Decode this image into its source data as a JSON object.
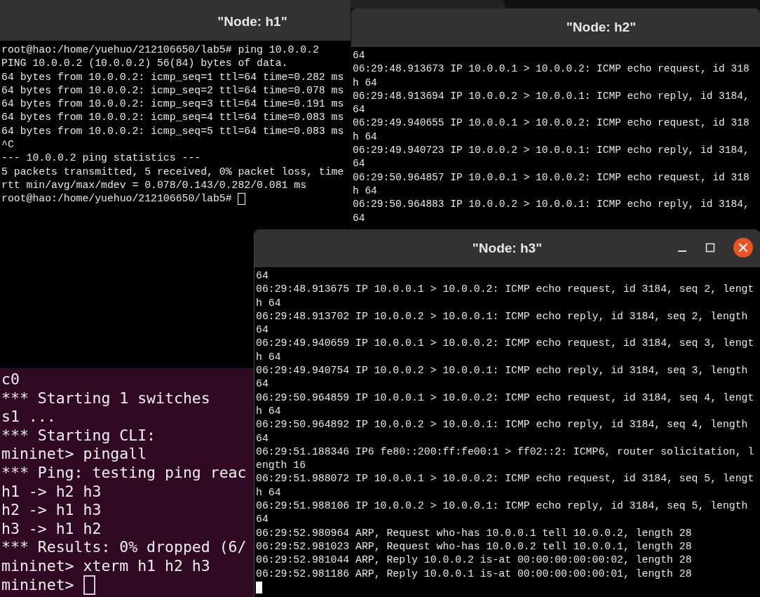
{
  "windows": [
    {
      "title": "\"Node: h1\"",
      "focused": false,
      "cursor": true,
      "lines": [
        "root@hao:/home/yuehuo/212106650/lab5# ping 10.0.0.2",
        "PING 10.0.0.2 (10.0.0.2) 56(84) bytes of data.",
        "64 bytes from 10.0.0.2: icmp_seq=1 ttl=64 time=0.282 ms",
        "64 bytes from 10.0.0.2: icmp_seq=2 ttl=64 time=0.078 ms",
        "64 bytes from 10.0.0.2: icmp_seq=3 ttl=64 time=0.191 ms",
        "64 bytes from 10.0.0.2: icmp_seq=4 ttl=64 time=0.083 ms",
        "64 bytes from 10.0.0.2: icmp_seq=5 ttl=64 time=0.083 ms",
        "^C",
        "--- 10.0.0.2 ping statistics ---",
        "5 packets transmitted, 5 received, 0% packet loss, time",
        "rtt min/avg/max/mdev = 0.078/0.143/0.282/0.081 ms",
        "root@hao:/home/yuehuo/212106650/lab5# "
      ]
    },
    {
      "title": "\"Node: h2\"",
      "focused": false,
      "lines": [
        "64",
        "06:29:48.913673 IP 10.0.0.1 > 10.0.0.2: ICMP echo request, id 318",
        "h 64",
        "06:29:48.913694 IP 10.0.0.2 > 10.0.0.1: ICMP echo reply, id 3184,",
        "64",
        "06:29:49.940655 IP 10.0.0.1 > 10.0.0.2: ICMP echo request, id 318",
        "h 64",
        "06:29:49.940723 IP 10.0.0.2 > 10.0.0.1: ICMP echo reply, id 3184,",
        "64",
        "06:29:50.964857 IP 10.0.0.1 > 10.0.0.2: ICMP echo request, id 318",
        "h 64",
        "06:29:50.964883 IP 10.0.0.2 > 10.0.0.1: ICMP echo reply, id 3184,",
        "64"
      ]
    },
    {
      "title": "\"Node: h3\"",
      "focused": true,
      "cursor": true,
      "lines": [
        "64",
        "06:29:48.913675 IP 10.0.0.1 > 10.0.0.2: ICMP echo request, id 3184, seq 2, lengt",
        "h 64",
        "06:29:48.913702 IP 10.0.0.2 > 10.0.0.1: ICMP echo reply, id 3184, seq 2, length",
        "64",
        "06:29:49.940659 IP 10.0.0.1 > 10.0.0.2: ICMP echo request, id 3184, seq 3, lengt",
        "h 64",
        "06:29:49.940754 IP 10.0.0.2 > 10.0.0.1: ICMP echo reply, id 3184, seq 3, length",
        "64",
        "06:29:50.964859 IP 10.0.0.1 > 10.0.0.2: ICMP echo request, id 3184, seq 4, lengt",
        "h 64",
        "06:29:50.964892 IP 10.0.0.2 > 10.0.0.1: ICMP echo reply, id 3184, seq 4, length",
        "64",
        "06:29:51.188346 IP6 fe80::200:ff:fe00:1 > ff02::2: ICMP6, router solicitation, l",
        "ength 16",
        "06:29:51.988072 IP 10.0.0.1 > 10.0.0.2: ICMP echo request, id 3184, seq 5, lengt",
        "h 64",
        "06:29:51.988106 IP 10.0.0.2 > 10.0.0.1: ICMP echo reply, id 3184, seq 5, length",
        "64",
        "06:29:52.980964 ARP, Request who-has 10.0.0.1 tell 10.0.0.2, length 28",
        "06:29:52.981023 ARP, Request who-has 10.0.0.2 tell 10.0.0.1, length 28",
        "06:29:52.981044 ARP, Reply 10.0.0.2 is-at 00:00:00:00:00:02, length 28",
        "06:29:52.981186 ARP, Reply 10.0.0.1 is-at 00:00:00:00:00:01, length 28"
      ]
    }
  ],
  "console": {
    "cursor": true,
    "lines": [
      "c0",
      "*** Starting 1 switches",
      "s1 ...",
      "*** Starting CLI:",
      "mininet> pingall",
      "*** Ping: testing ping reac",
      "h1 -> h2 h3",
      "h2 -> h1 h3",
      "h3 -> h1 h2",
      "*** Results: 0% dropped (6/",
      "mininet> xterm h1 h2 h3",
      "mininet> "
    ]
  }
}
